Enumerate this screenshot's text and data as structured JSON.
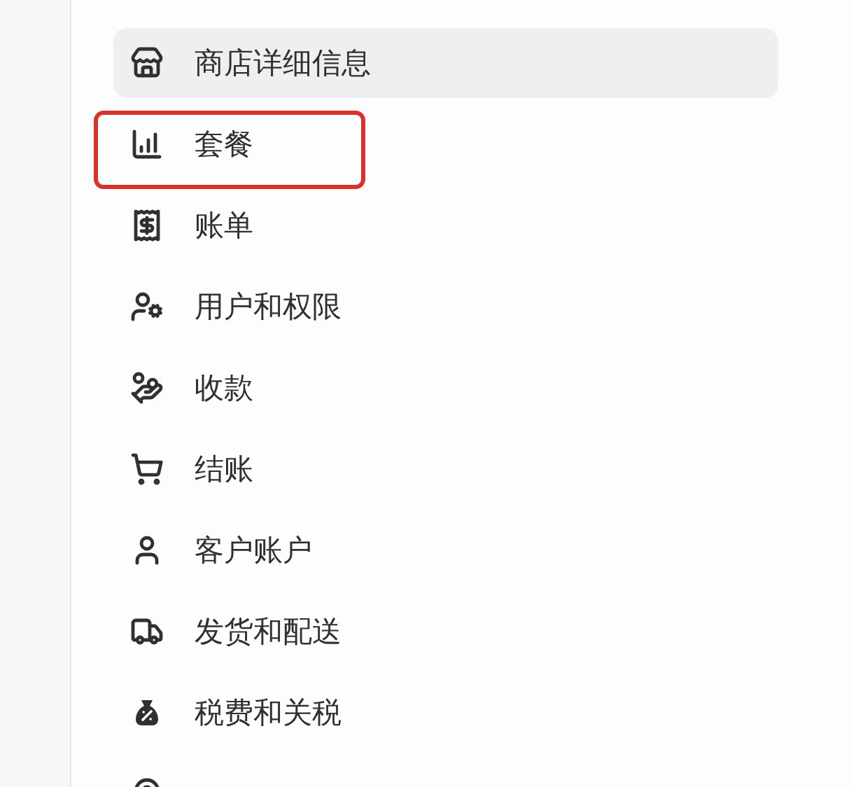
{
  "settings_menu": {
    "items": [
      {
        "label": "商店详细信息",
        "selected": true,
        "highlighted": false
      },
      {
        "label": "套餐",
        "selected": false,
        "highlighted": true
      },
      {
        "label": "账单",
        "selected": false,
        "highlighted": false
      },
      {
        "label": "用户和权限",
        "selected": false,
        "highlighted": false
      },
      {
        "label": "收款",
        "selected": false,
        "highlighted": false
      },
      {
        "label": "结账",
        "selected": false,
        "highlighted": false
      },
      {
        "label": "客户账户",
        "selected": false,
        "highlighted": false
      },
      {
        "label": "发货和配送",
        "selected": false,
        "highlighted": false
      },
      {
        "label": "税费和关税",
        "selected": false,
        "highlighted": false
      },
      {
        "selected": false,
        "highlighted": false
      }
    ]
  }
}
